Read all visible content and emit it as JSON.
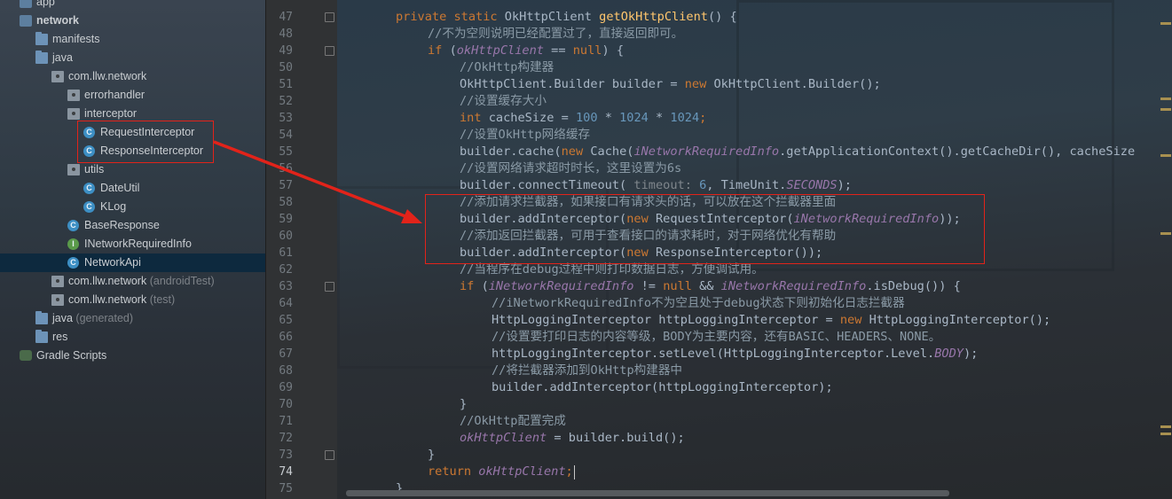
{
  "tree": [
    {
      "label": "app",
      "icon": "module",
      "indent": 0,
      "arrow": ""
    },
    {
      "label": "network",
      "icon": "module",
      "indent": 0,
      "arrow": "▼",
      "bold": true
    },
    {
      "label": "manifests",
      "icon": "folder",
      "indent": 1,
      "arrow": "▶"
    },
    {
      "label": "java",
      "icon": "folder",
      "indent": 1,
      "arrow": "▼"
    },
    {
      "label": "com.llw.network",
      "icon": "package",
      "indent": 2,
      "arrow": "▼"
    },
    {
      "label": "errorhandler",
      "icon": "package",
      "indent": 3,
      "arrow": "▶"
    },
    {
      "label": "interceptor",
      "icon": "package",
      "indent": 3,
      "arrow": "▼"
    },
    {
      "label": "RequestInterceptor",
      "icon": "class",
      "indent": 4,
      "arrow": ""
    },
    {
      "label": "ResponseInterceptor",
      "icon": "class",
      "indent": 4,
      "arrow": ""
    },
    {
      "label": "utils",
      "icon": "package",
      "indent": 3,
      "arrow": "▼"
    },
    {
      "label": "DateUtil",
      "icon": "class",
      "indent": 4,
      "arrow": ""
    },
    {
      "label": "KLog",
      "icon": "class",
      "indent": 4,
      "arrow": ""
    },
    {
      "label": "BaseResponse",
      "icon": "class",
      "indent": 3,
      "arrow": ""
    },
    {
      "label": "INetworkRequiredInfo",
      "icon": "interface",
      "indent": 3,
      "arrow": ""
    },
    {
      "label": "NetworkApi",
      "icon": "class",
      "indent": 3,
      "arrow": "",
      "selected": true
    },
    {
      "label": "com.llw.network",
      "suffix": "(androidTest)",
      "icon": "package",
      "indent": 2,
      "arrow": "▶"
    },
    {
      "label": "com.llw.network",
      "suffix": "(test)",
      "icon": "package",
      "indent": 2,
      "arrow": "▶"
    },
    {
      "label": "java",
      "suffix": "(generated)",
      "icon": "folder",
      "indent": 1,
      "arrow": "▶"
    },
    {
      "label": "res",
      "icon": "folder",
      "indent": 1,
      "arrow": "▶"
    },
    {
      "label": "Gradle Scripts",
      "icon": "gradle",
      "indent": 0,
      "arrow": "▶"
    }
  ],
  "editor": {
    "current_line": 74,
    "lines": [
      {
        "n": 47,
        "indent": 1,
        "tokens": [
          [
            "kw",
            "private static "
          ],
          [
            "",
            "OkHttpClient "
          ],
          [
            "fn",
            "getOkHttpClient"
          ],
          [
            "",
            "() {"
          ]
        ]
      },
      {
        "n": 48,
        "indent": 2,
        "tokens": [
          [
            "cm",
            "//不为空则说明已经配置过了，直接返回即可。"
          ]
        ]
      },
      {
        "n": 49,
        "indent": 2,
        "tokens": [
          [
            "kw",
            "if "
          ],
          [
            "",
            "("
          ],
          [
            "fld",
            "okHttpClient"
          ],
          [
            "",
            " == "
          ],
          [
            "kw",
            "null"
          ],
          [
            "",
            ") {"
          ]
        ]
      },
      {
        "n": 50,
        "indent": 3,
        "tokens": [
          [
            "cm",
            "//OkHttp构建器"
          ]
        ]
      },
      {
        "n": 51,
        "indent": 3,
        "tokens": [
          [
            "",
            "OkHttpClient.Builder builder = "
          ],
          [
            "kw",
            "new "
          ],
          [
            "",
            "OkHttpClient.Builder();"
          ]
        ]
      },
      {
        "n": 52,
        "indent": 3,
        "tokens": [
          [
            "cm",
            "//设置缓存大小"
          ]
        ]
      },
      {
        "n": 53,
        "indent": 3,
        "tokens": [
          [
            "kw",
            "int "
          ],
          [
            "",
            "cacheSize = "
          ],
          [
            "num",
            "100"
          ],
          [
            "",
            " * "
          ],
          [
            "num",
            "1024"
          ],
          [
            "",
            " * "
          ],
          [
            "num",
            "1024"
          ],
          [
            "kw",
            ";"
          ]
        ]
      },
      {
        "n": 54,
        "indent": 3,
        "tokens": [
          [
            "cm",
            "//设置OkHttp网络缓存"
          ]
        ]
      },
      {
        "n": 55,
        "indent": 3,
        "tokens": [
          [
            "",
            "builder.cache("
          ],
          [
            "kw",
            "new "
          ],
          [
            "",
            "Cache("
          ],
          [
            "fld",
            "iNetworkRequiredInfo"
          ],
          [
            "",
            ".getApplicationContext().getCacheDir(), cacheSize"
          ]
        ]
      },
      {
        "n": 56,
        "indent": 3,
        "tokens": [
          [
            "cm",
            "//设置网络请求超时时长，这里设置为6s"
          ]
        ]
      },
      {
        "n": 57,
        "indent": 3,
        "tokens": [
          [
            "",
            "builder.connectTimeout( "
          ],
          [
            "hint",
            "timeout: "
          ],
          [
            "num",
            "6"
          ],
          [
            "",
            ", TimeUnit."
          ],
          [
            "fld",
            "SECONDS"
          ],
          [
            "",
            ");"
          ]
        ]
      },
      {
        "n": 58,
        "indent": 3,
        "tokens": [
          [
            "cm",
            "//添加请求拦截器，如果接口有请求头的话，可以放在这个拦截器里面"
          ]
        ]
      },
      {
        "n": 59,
        "indent": 3,
        "tokens": [
          [
            "",
            "builder.addInterceptor("
          ],
          [
            "kw",
            "new "
          ],
          [
            "",
            "RequestInterceptor("
          ],
          [
            "fld",
            "iNetworkRequiredInfo"
          ],
          [
            "",
            "));"
          ]
        ]
      },
      {
        "n": 60,
        "indent": 3,
        "tokens": [
          [
            "cm",
            "//添加返回拦截器，可用于查看接口的请求耗时，对于网络优化有帮助"
          ]
        ]
      },
      {
        "n": 61,
        "indent": 3,
        "tokens": [
          [
            "",
            "builder.addInterceptor("
          ],
          [
            "kw",
            "new "
          ],
          [
            "",
            "ResponseInterceptor());"
          ]
        ]
      },
      {
        "n": 62,
        "indent": 3,
        "tokens": [
          [
            "cm",
            "//当程序在debug过程中则打印数据日志，方便调试用。"
          ]
        ]
      },
      {
        "n": 63,
        "indent": 3,
        "tokens": [
          [
            "kw",
            "if "
          ],
          [
            "",
            "("
          ],
          [
            "fld",
            "iNetworkRequiredInfo"
          ],
          [
            "",
            " != "
          ],
          [
            "kw",
            "null "
          ],
          [
            "",
            "&& "
          ],
          [
            "fld",
            "iNetworkRequiredInfo"
          ],
          [
            "",
            ".isDebug()) {"
          ]
        ]
      },
      {
        "n": 64,
        "indent": 4,
        "tokens": [
          [
            "cm",
            "//iNetworkRequiredInfo不为空且处于debug状态下则初始化日志拦截器"
          ]
        ]
      },
      {
        "n": 65,
        "indent": 4,
        "tokens": [
          [
            "",
            "HttpLoggingInterceptor httpLoggingInterceptor = "
          ],
          [
            "kw",
            "new "
          ],
          [
            "",
            "HttpLoggingInterceptor();"
          ]
        ]
      },
      {
        "n": 66,
        "indent": 4,
        "tokens": [
          [
            "cm",
            "//设置要打印日志的内容等级，BODY为主要内容，还有BASIC、HEADERS、NONE。"
          ]
        ]
      },
      {
        "n": 67,
        "indent": 4,
        "tokens": [
          [
            "",
            "httpLoggingInterceptor.setLevel(HttpLoggingInterceptor.Level."
          ],
          [
            "fld",
            "BODY"
          ],
          [
            "",
            ");"
          ]
        ]
      },
      {
        "n": 68,
        "indent": 4,
        "tokens": [
          [
            "cm",
            "//将拦截器添加到OkHttp构建器中"
          ]
        ]
      },
      {
        "n": 69,
        "indent": 4,
        "tokens": [
          [
            "",
            "builder.addInterceptor(httpLoggingInterceptor);"
          ]
        ]
      },
      {
        "n": 70,
        "indent": 3,
        "tokens": [
          [
            "",
            "}"
          ]
        ]
      },
      {
        "n": 71,
        "indent": 3,
        "tokens": [
          [
            "cm",
            "//OkHttp配置完成"
          ]
        ]
      },
      {
        "n": 72,
        "indent": 3,
        "tokens": [
          [
            "fld",
            "okHttpClient"
          ],
          [
            "",
            " = builder.build();"
          ]
        ]
      },
      {
        "n": 73,
        "indent": 2,
        "tokens": [
          [
            "",
            "}"
          ]
        ]
      },
      {
        "n": 74,
        "indent": 2,
        "tokens": [
          [
            "kw",
            "return "
          ],
          [
            "fld",
            "okHttpClient"
          ],
          [
            "kw",
            ";"
          ]
        ]
      },
      {
        "n": 75,
        "indent": 1,
        "tokens": [
          [
            "",
            "}"
          ]
        ]
      }
    ]
  },
  "colors": {
    "annotation_red": "#e2231a",
    "keyword": "#cc7832",
    "field": "#9876aa",
    "number": "#6897bb",
    "method": "#ffc66d"
  }
}
